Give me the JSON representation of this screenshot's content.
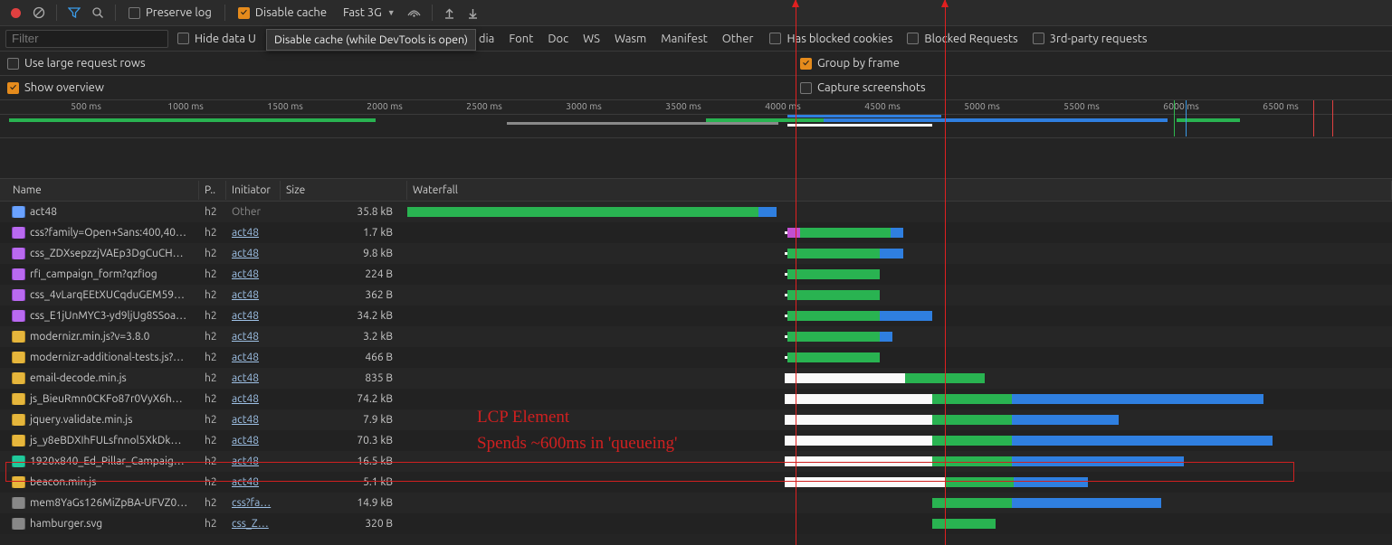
{
  "toolbar": {
    "preserve_log": "Preserve log",
    "disable_cache": "Disable cache",
    "throttle_value": "Fast 3G",
    "tooltip": "Disable cache (while DevTools is open)"
  },
  "filter": {
    "placeholder": "Filter",
    "hide_data": "Hide data U",
    "types_visible": [
      "dia",
      "Font",
      "Doc",
      "WS",
      "Wasm",
      "Manifest",
      "Other"
    ],
    "has_blocked_cookies": "Has blocked cookies",
    "blocked_requests": "Blocked Requests",
    "third_party": "3rd-party requests"
  },
  "options": {
    "large_rows": "Use large request rows",
    "group_by_frame": "Group by frame",
    "show_overview": "Show overview",
    "capture_screenshots": "Capture screenshots"
  },
  "overview": {
    "ticks": [
      "500 ms",
      "1000 ms",
      "1500 ms",
      "2000 ms",
      "2500 ms",
      "3000 ms",
      "3500 ms",
      "4000 ms",
      "4500 ms",
      "5000 ms",
      "5500 ms",
      "6000 ms",
      "6500 ms"
    ]
  },
  "columns": {
    "name": "Name",
    "p": "P..",
    "init": "Initiator",
    "size": "Size",
    "wf": "Waterfall"
  },
  "rows": [
    {
      "icon": "fi-doc",
      "name": "act48",
      "p": "h2",
      "init": "Other",
      "init_dim": true,
      "size": "35.8 kB",
      "wf": [
        [
          "g",
          0,
          388
        ],
        [
          "b",
          388,
          20
        ]
      ],
      "q": null
    },
    {
      "icon": "fi-css",
      "name": "css?family=Open+Sans:400,40…",
      "p": "h2",
      "init": "act48",
      "size": "1.7 kB",
      "wf": [
        [
          "m",
          0,
          14
        ],
        [
          "g",
          14,
          100
        ],
        [
          "b",
          114,
          14
        ]
      ],
      "q": [
        -3,
        3
      ]
    },
    {
      "icon": "fi-css",
      "name": "css_ZDXsepzzjVAEp3DgCuCH…",
      "p": "h2",
      "init": "act48",
      "size": "9.8 kB",
      "wf": [
        [
          "g",
          0,
          102
        ],
        [
          "b",
          102,
          26
        ]
      ],
      "q": [
        -3,
        3
      ]
    },
    {
      "icon": "fi-css",
      "name": "rfi_campaign_form?qzfiog",
      "p": "h2",
      "init": "act48",
      "size": "224 B",
      "wf": [
        [
          "g",
          0,
          102
        ]
      ],
      "q": [
        -3,
        3
      ]
    },
    {
      "icon": "fi-css",
      "name": "css_4vLarqEEtXUCqduGEM59…",
      "p": "h2",
      "init": "act48",
      "size": "362 B",
      "wf": [
        [
          "g",
          0,
          102
        ]
      ],
      "q": [
        -3,
        3
      ]
    },
    {
      "icon": "fi-css",
      "name": "css_E1jUnMYC3-yd9ljUg8SSoa…",
      "p": "h2",
      "init": "act48",
      "size": "34.2 kB",
      "wf": [
        [
          "g",
          0,
          102
        ],
        [
          "b",
          102,
          58
        ]
      ],
      "q": [
        -3,
        3
      ]
    },
    {
      "icon": "fi-js",
      "name": "modernizr.min.js?v=3.8.0",
      "p": "h2",
      "init": "act48",
      "size": "3.2 kB",
      "wf": [
        [
          "g",
          0,
          102
        ],
        [
          "b",
          102,
          14
        ]
      ],
      "q": [
        -3,
        3
      ]
    },
    {
      "icon": "fi-js",
      "name": "modernizr-additional-tests.js?…",
      "p": "h2",
      "init": "act48",
      "size": "466 B",
      "wf": [
        [
          "g",
          0,
          102
        ]
      ],
      "q": [
        -3,
        3
      ]
    },
    {
      "icon": "fi-js",
      "name": "email-decode.min.js",
      "p": "h2",
      "init": "act48",
      "size": "835 B",
      "wf": [
        [
          "g",
          130,
          88
        ]
      ],
      "q": [
        -3,
        130
      ]
    },
    {
      "icon": "fi-js",
      "name": "js_BieuRmn0CKFo87r0VyX6h…",
      "p": "h2",
      "init": "act48",
      "size": "74.2 kB",
      "wf": [
        [
          "g",
          160,
          88
        ],
        [
          "b",
          248,
          278
        ]
      ],
      "q": [
        -3,
        160
      ]
    },
    {
      "icon": "fi-js",
      "name": "jquery.validate.min.js",
      "p": "h2",
      "init": "act48",
      "size": "7.9 kB",
      "wf": [
        [
          "g",
          160,
          88
        ],
        [
          "b",
          248,
          118
        ]
      ],
      "q": [
        -3,
        160
      ]
    },
    {
      "icon": "fi-js",
      "name": "js_y8eBDXIhFULsfnnol5XkDk…",
      "p": "h2",
      "init": "act48",
      "size": "70.3 kB",
      "wf": [
        [
          "g",
          160,
          88
        ],
        [
          "b",
          248,
          288
        ]
      ],
      "q": [
        -3,
        160
      ]
    },
    {
      "icon": "fi-img",
      "name": "1920x840_Ed_Pillar_Campaig…",
      "p": "h2",
      "init": "act48",
      "size": "16.5 kB",
      "wf": [
        [
          "g",
          160,
          88
        ],
        [
          "b",
          248,
          190
        ]
      ],
      "q": [
        -3,
        160
      ]
    },
    {
      "icon": "fi-js",
      "name": "beacon.min.js",
      "p": "h2",
      "init": "act48",
      "size": "5.1 kB",
      "wf": [
        [
          "g",
          175,
          75
        ],
        [
          "b",
          250,
          82
        ]
      ],
      "q": [
        -3,
        175
      ]
    },
    {
      "icon": "fi-oth",
      "name": "mem8YaGs126MiZpBA-UFVZ0…",
      "p": "h2",
      "init": "css?fa…",
      "size": "14.9 kB",
      "wf": [
        [
          "g",
          160,
          88
        ],
        [
          "b",
          248,
          165
        ]
      ],
      "q": null
    },
    {
      "icon": "fi-oth",
      "name": "hamburger.svg",
      "p": "h2",
      "init": "css_Z…",
      "size": "320 B",
      "wf": [
        [
          "g",
          160,
          70
        ]
      ],
      "q": null
    }
  ],
  "annotations": {
    "line1": "LCP Element",
    "line2": "Spends ~600ms in 'queueing'"
  }
}
